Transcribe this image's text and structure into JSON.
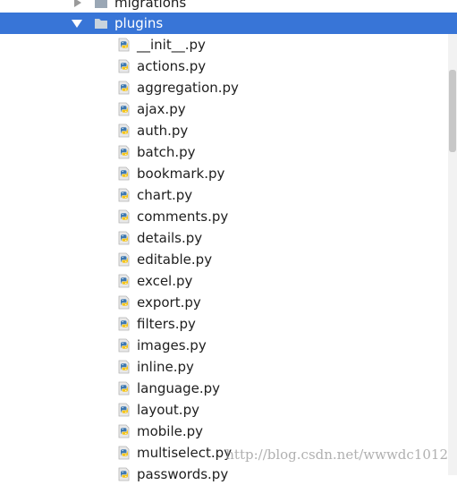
{
  "tree": {
    "migrations": {
      "label": "migrations",
      "icon": "folder-icon",
      "expanded": false
    },
    "plugins": {
      "label": "plugins",
      "icon": "folder-icon",
      "expanded": true,
      "selected": true
    },
    "files": [
      "__init__.py",
      "actions.py",
      "aggregation.py",
      "ajax.py",
      "auth.py",
      "batch.py",
      "bookmark.py",
      "chart.py",
      "comments.py",
      "details.py",
      "editable.py",
      "excel.py",
      "export.py",
      "filters.py",
      "images.py",
      "inline.py",
      "language.py",
      "layout.py",
      "mobile.py",
      "multiselect.py",
      "passwords.py"
    ],
    "file_icon": "python-file-icon"
  },
  "watermark": "http://blog.csdn.net/wwwdc1012",
  "colors": {
    "selection": "#3875d7",
    "python_blue": "#3f79b1",
    "python_yellow": "#f5c518"
  }
}
